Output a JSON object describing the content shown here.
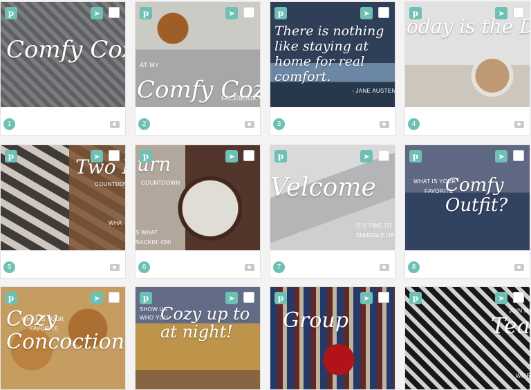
{
  "colors": {
    "accent": "#6ec0b4"
  },
  "icons": {
    "pin": "pinterest-icon",
    "send": "paper-plane-icon",
    "photo": "camera-icon"
  },
  "tiles": [
    {
      "num": "1",
      "caption": "Comfy Cozy",
      "sub": []
    },
    {
      "num": "2",
      "caption": "Comfy Cozy",
      "sub": [
        "AT MY",
        "FACEBOOK PAR"
      ]
    },
    {
      "num": "3",
      "caption": "There is nothing like staying at home for real comfort.",
      "sub": [
        "- JANE AUSTEN"
      ]
    },
    {
      "num": "4",
      "caption": "oday is the Day",
      "sub": []
    },
    {
      "num": "5",
      "caption": "Two Ho",
      "sub": [
        "COUNTDOV",
        "WHA"
      ]
    },
    {
      "num": "6",
      "caption": "urn",
      "sub": [
        "COUNTDOWN",
        "S WHAT",
        "NACKIN' ON!"
      ]
    },
    {
      "num": "7",
      "caption": "Velcome",
      "sub": [
        "IT'S TIME TO",
        "SNUGGLE UP!"
      ]
    },
    {
      "num": "8",
      "caption": "Comfy Outfit?",
      "sub": [
        "WHAT IS YOUR",
        "FAVORITE"
      ]
    },
    {
      "num": "",
      "caption": "Cozy Concoction?",
      "sub": [
        "WHAT IS YOUR",
        "FAVORITE"
      ]
    },
    {
      "num": "",
      "caption": "Cozy up to at night!",
      "sub": [
        "SHOW US",
        "WHO YOU"
      ]
    },
    {
      "num": "",
      "caption": "Group",
      "sub": []
    },
    {
      "num": "",
      "caption": "Tear",
      "sub": [
        "JOIN MY",
        "WE'R"
      ]
    }
  ]
}
